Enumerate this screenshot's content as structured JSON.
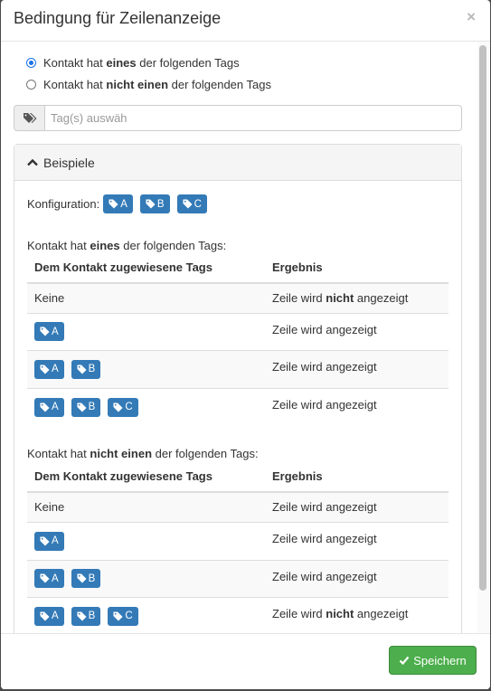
{
  "dialog": {
    "title": "Bedingung für Zeilenanzeige",
    "close_label": "×"
  },
  "mode": {
    "option1_prefix": "Kontakt hat ",
    "option1_bold": "eines",
    "option1_suffix": " der folgenden Tags",
    "option2_prefix": "Kontakt hat ",
    "option2_bold": "nicht einen",
    "option2_suffix": " der folgenden Tags",
    "selected": "option1"
  },
  "tag_select": {
    "placeholder": "Tag(s) auswäh",
    "icon": "tags-icon"
  },
  "examples": {
    "heading": "Beispiele",
    "config_label": "Konfiguration:",
    "config_tags": [
      "A",
      "B",
      "C"
    ],
    "col_tags": "Dem Kontakt zugewiesene Tags",
    "col_result": "Ergebnis",
    "none_label": "Keine",
    "section1": {
      "prefix": "Kontakt hat ",
      "bold": "eines",
      "suffix": " der folgenden Tags:",
      "rows": [
        {
          "tags": [],
          "result_prefix": "Zeile wird ",
          "result_bold": "nicht",
          "result_suffix": " angezeigt"
        },
        {
          "tags": [
            "A"
          ],
          "result_prefix": "Zeile wird angezeigt",
          "result_bold": "",
          "result_suffix": ""
        },
        {
          "tags": [
            "A",
            "B"
          ],
          "result_prefix": "Zeile wird angezeigt",
          "result_bold": "",
          "result_suffix": ""
        },
        {
          "tags": [
            "A",
            "B",
            "C"
          ],
          "result_prefix": "Zeile wird angezeigt",
          "result_bold": "",
          "result_suffix": ""
        }
      ]
    },
    "section2": {
      "prefix": "Kontakt hat ",
      "bold": "nicht einen",
      "suffix": " der folgenden Tags:",
      "rows": [
        {
          "tags": [],
          "result_prefix": "Zeile wird angezeigt",
          "result_bold": "",
          "result_suffix": ""
        },
        {
          "tags": [
            "A"
          ],
          "result_prefix": "Zeile wird angezeigt",
          "result_bold": "",
          "result_suffix": ""
        },
        {
          "tags": [
            "A",
            "B"
          ],
          "result_prefix": "Zeile wird angezeigt",
          "result_bold": "",
          "result_suffix": ""
        },
        {
          "tags": [
            "A",
            "B",
            "C"
          ],
          "result_prefix": "Zeile wird ",
          "result_bold": "nicht",
          "result_suffix": " angezeigt"
        }
      ]
    }
  },
  "footer": {
    "save_label": "Speichern"
  },
  "colors": {
    "tag_badge": "#337ab7",
    "save_button": "#4cae4c",
    "radio_accent": "#1a73e8"
  }
}
